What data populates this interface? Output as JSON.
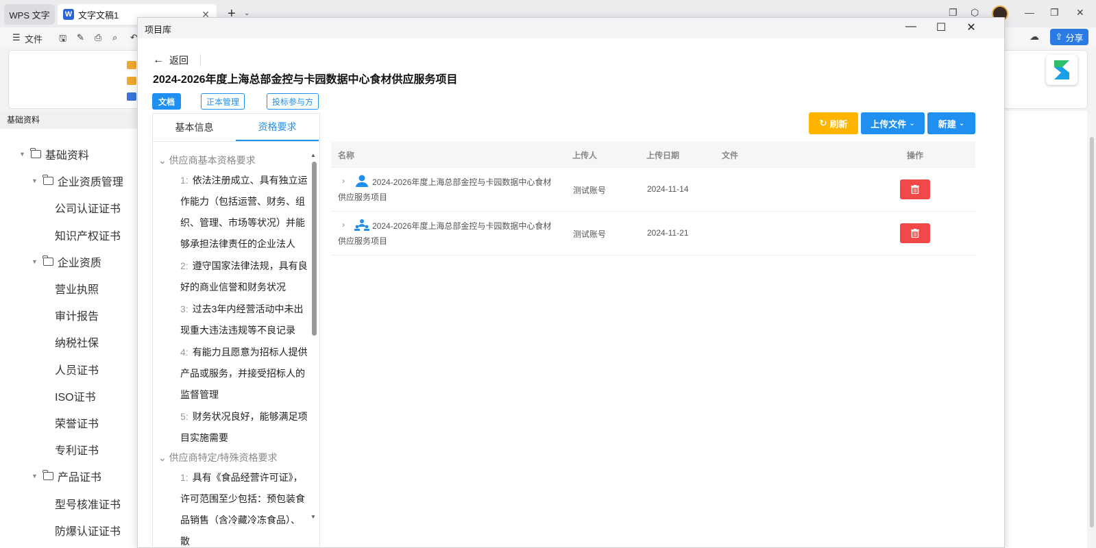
{
  "wps": {
    "tab_wps": "WPS 文字",
    "doc_badge": "W",
    "tab_doc": "文字文稿1",
    "file_menu": "文件",
    "share": "分享"
  },
  "bg_tree": {
    "header": "基础资料",
    "items": [
      {
        "label": "基础资料",
        "level": 0,
        "folder": true
      },
      {
        "label": "企业资质管理",
        "level": 1,
        "folder": true
      },
      {
        "label": "公司认证证书",
        "level": 2,
        "folder": false
      },
      {
        "label": "知识产权证书",
        "level": 2,
        "folder": false
      },
      {
        "label": "企业资质",
        "level": 1,
        "folder": true
      },
      {
        "label": "营业执照",
        "level": 2,
        "folder": false
      },
      {
        "label": "审计报告",
        "level": 2,
        "folder": false
      },
      {
        "label": "纳税社保",
        "level": 2,
        "folder": false
      },
      {
        "label": "人员证书",
        "level": 2,
        "folder": false
      },
      {
        "label": "ISO证书",
        "level": 2,
        "folder": false
      },
      {
        "label": "荣誉证书",
        "level": 2,
        "folder": false
      },
      {
        "label": "专利证书",
        "level": 2,
        "folder": false
      },
      {
        "label": "产品证书",
        "level": 1,
        "folder": true
      },
      {
        "label": "型号核准证书",
        "level": 2,
        "folder": false
      },
      {
        "label": "防爆认证证书",
        "level": 2,
        "folder": false
      }
    ]
  },
  "dialog": {
    "title": "项目库",
    "back": "返回",
    "project_title": "2024-2026年度上海总部金控与卡园数据中心食材供应服务项目",
    "mode_tabs": [
      "文档",
      "正本管理",
      "投标参与方"
    ],
    "left_tabs": [
      "基本信息",
      "资格要求"
    ],
    "sections": [
      {
        "title": "供应商基本资格要求",
        "items": [
          {
            "num": "1:",
            "text": "依法注册成立、具有独立运作能力（包括运营、财务、组织、管理、市场等状况）并能够承担法律责任的企业法人"
          },
          {
            "num": "2:",
            "text": "遵守国家法律法规，具有良好的商业信誉和财务状况"
          },
          {
            "num": "3:",
            "text": "过去3年内经营活动中未出现重大违法违规等不良记录"
          },
          {
            "num": "4:",
            "text": "有能力且愿意为招标人提供产品或服务，并接受招标人的监督管理"
          },
          {
            "num": "5:",
            "text": "财务状况良好，能够满足项目实施需要"
          }
        ]
      },
      {
        "title": "供应商特定/特殊资格要求",
        "items": [
          {
            "num": "1:",
            "text": "具有《食品经营许可证》，许可范围至少包括：预包装食品销售（含冷藏冷冻食品）、散"
          }
        ]
      }
    ],
    "buttons": {
      "refresh": "刷新",
      "upload": "上传文件",
      "new": "新建"
    },
    "table": {
      "columns": [
        "名称",
        "上传人",
        "上传日期",
        "文件",
        "操作"
      ],
      "rows": [
        {
          "name": "2024-2026年度上海总部金控与卡园数据中心食材供应服务项目",
          "uploader": "测试账号",
          "date": "2024-11-14",
          "file": "",
          "icon": "person-icon"
        },
        {
          "name": "2024-2026年度上海总部金控与卡园数据中心食材供应服务项目",
          "uploader": "测试账号",
          "date": "2024-11-21",
          "file": "",
          "icon": "group-icon"
        }
      ]
    }
  },
  "colors": {
    "primary": "#1f8ff0",
    "refresh": "#ffb400",
    "danger": "#f24848"
  }
}
